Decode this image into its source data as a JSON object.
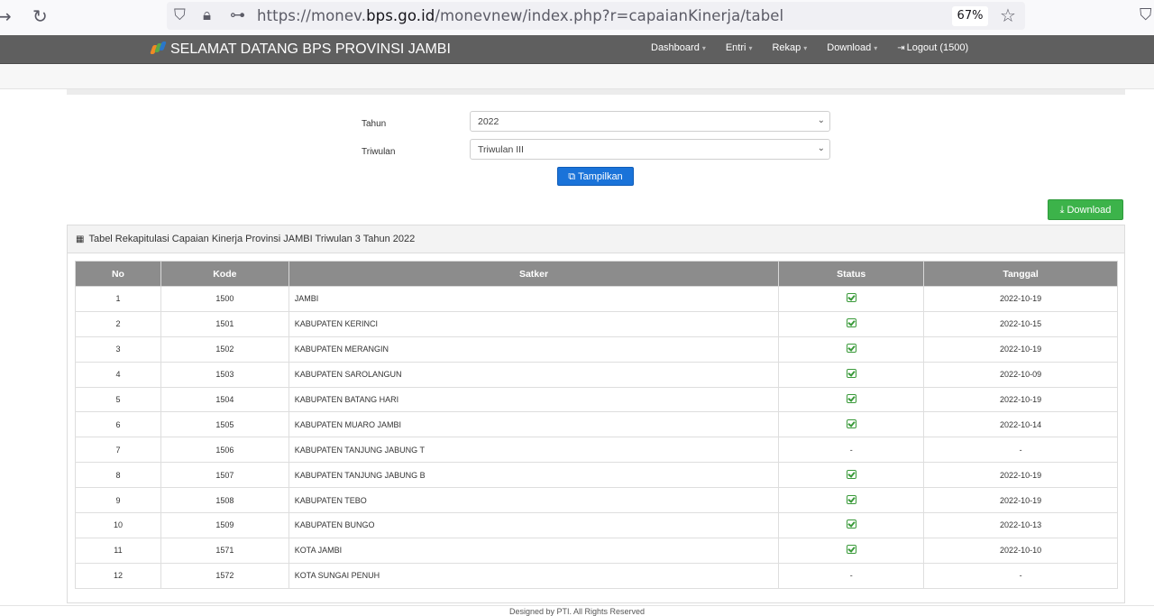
{
  "browser": {
    "url_prefix": "https://monev.",
    "url_domain": "bps.go.id",
    "url_path": "/monevnew/index.php?r=capaianKinerja/tabel",
    "zoom": "67%"
  },
  "navbar": {
    "brand": "SELAMAT DATANG BPS PROVINSI JAMBI",
    "menu": [
      {
        "label": "Dashboard",
        "caret": true
      },
      {
        "label": "Entri",
        "caret": true
      },
      {
        "label": "Rekap",
        "caret": true
      },
      {
        "label": "Download",
        "caret": true
      },
      {
        "label": "Logout (1500)",
        "caret": false
      }
    ]
  },
  "form": {
    "tahun_label": "Tahun",
    "tahun_value": "2022",
    "triwulan_label": "Triwulan",
    "triwulan_value": "Triwulan III",
    "submit_label": "Tampilkan"
  },
  "download_label": "Download",
  "panel": {
    "title": "Tabel Rekapitulasi Capaian Kinerja Provinsi JAMBI Triwulan 3 Tahun 2022"
  },
  "table": {
    "headers": [
      "No",
      "Kode",
      "Satker",
      "Status",
      "Tanggal"
    ],
    "rows": [
      {
        "no": "1",
        "kode": "1500",
        "satker": "JAMBI",
        "status": "check",
        "tanggal": "2022-10-19"
      },
      {
        "no": "2",
        "kode": "1501",
        "satker": "KABUPATEN KERINCI",
        "status": "check",
        "tanggal": "2022-10-15"
      },
      {
        "no": "3",
        "kode": "1502",
        "satker": "KABUPATEN MERANGIN",
        "status": "check",
        "tanggal": "2022-10-19"
      },
      {
        "no": "4",
        "kode": "1503",
        "satker": "KABUPATEN SAROLANGUN",
        "status": "check",
        "tanggal": "2022-10-09"
      },
      {
        "no": "5",
        "kode": "1504",
        "satker": "KABUPATEN BATANG HARI",
        "status": "check",
        "tanggal": "2022-10-19"
      },
      {
        "no": "6",
        "kode": "1505",
        "satker": "KABUPATEN MUARO JAMBI",
        "status": "check",
        "tanggal": "2022-10-14"
      },
      {
        "no": "7",
        "kode": "1506",
        "satker": "KABUPATEN TANJUNG JABUNG T",
        "status": "-",
        "tanggal": "-"
      },
      {
        "no": "8",
        "kode": "1507",
        "satker": "KABUPATEN TANJUNG JABUNG B",
        "status": "check",
        "tanggal": "2022-10-19"
      },
      {
        "no": "9",
        "kode": "1508",
        "satker": "KABUPATEN TEBO",
        "status": "check",
        "tanggal": "2022-10-19"
      },
      {
        "no": "10",
        "kode": "1509",
        "satker": "KABUPATEN BUNGO",
        "status": "check",
        "tanggal": "2022-10-13"
      },
      {
        "no": "11",
        "kode": "1571",
        "satker": "KOTA JAMBI",
        "status": "check",
        "tanggal": "2022-10-10"
      },
      {
        "no": "12",
        "kode": "1572",
        "satker": "KOTA SUNGAI PENUH",
        "status": "-",
        "tanggal": "-"
      }
    ]
  },
  "footer": "Designed by PTI. All Rights Reserved"
}
